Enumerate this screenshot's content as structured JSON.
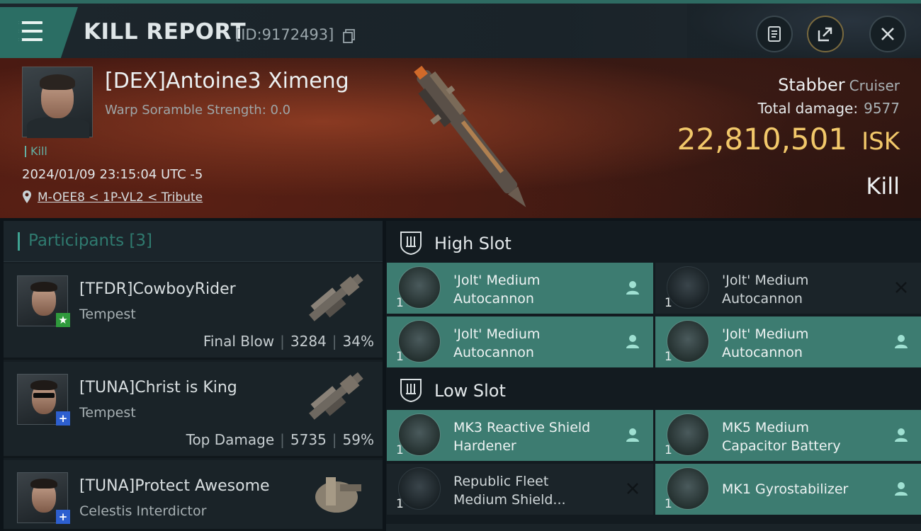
{
  "header": {
    "title": "KILL REPORT",
    "report_id": "[ID:9172493]"
  },
  "victim": {
    "name": "[DEX]Antoine3 Ximeng",
    "scramble": "Warp Soramble Strength: 0.0",
    "tag": "Kill",
    "datetime": "2024/01/09 23:15:04 UTC -5",
    "location": "M-OEE8 < 1P-VL2 < Tribute",
    "ship": "Stabber",
    "ship_class": "Cruiser",
    "damage_label": "Total damage:",
    "damage_value": "9577",
    "isk_value": "22,810,501",
    "isk_unit": "ISK",
    "result": "Kill"
  },
  "participants": {
    "label": "Participants",
    "count": "[3]",
    "rows": [
      {
        "name": "[TFDR]CowboyRider",
        "ship": "Tempest",
        "role": "Final Blow",
        "damage": "3284",
        "percent": "34%",
        "badge": "★"
      },
      {
        "name": "[TUNA]Christ is King",
        "ship": "Tempest",
        "role": "Top Damage",
        "damage": "5735",
        "percent": "59%",
        "badge": "+"
      },
      {
        "name": "[TUNA]Protect Awesome",
        "ship": "Celestis Interdictor",
        "role": "",
        "damage": "",
        "percent": "",
        "badge": "+"
      }
    ]
  },
  "fitting": {
    "high_slot_label": "High Slot",
    "low_slot_label": "Low Slot",
    "high": [
      {
        "line1": "'Jolt' Medium",
        "line2": "Autocannon",
        "qty": "1",
        "status": "person-icon",
        "highlight": true
      },
      {
        "line1": "'Jolt' Medium",
        "line2": "Autocannon",
        "qty": "1",
        "status": "close-icon",
        "highlight": false
      },
      {
        "line1": "'Jolt' Medium",
        "line2": "Autocannon",
        "qty": "1",
        "status": "person-icon",
        "highlight": true
      },
      {
        "line1": "'Jolt' Medium",
        "line2": "Autocannon",
        "qty": "1",
        "status": "person-icon",
        "highlight": true
      }
    ],
    "low": [
      {
        "line1": "MK3 Reactive Shield",
        "line2": "Hardener",
        "qty": "1",
        "status": "person-icon",
        "highlight": true
      },
      {
        "line1": "MK5 Medium",
        "line2": "Capacitor Battery",
        "qty": "1",
        "status": "person-icon",
        "highlight": true
      },
      {
        "line1": "Republic Fleet",
        "line2": "Medium Shield...",
        "qty": "1",
        "status": "close-icon",
        "highlight": false
      },
      {
        "line1": "MK1 Gyrostabilizer",
        "line2": "",
        "qty": "1",
        "status": "person-icon",
        "highlight": true
      }
    ]
  },
  "colors": {
    "accent": "#3d7c71",
    "isk": "#f2c86a",
    "badge_green": "#2f9a3c",
    "badge_blue": "#2d5fcf"
  }
}
